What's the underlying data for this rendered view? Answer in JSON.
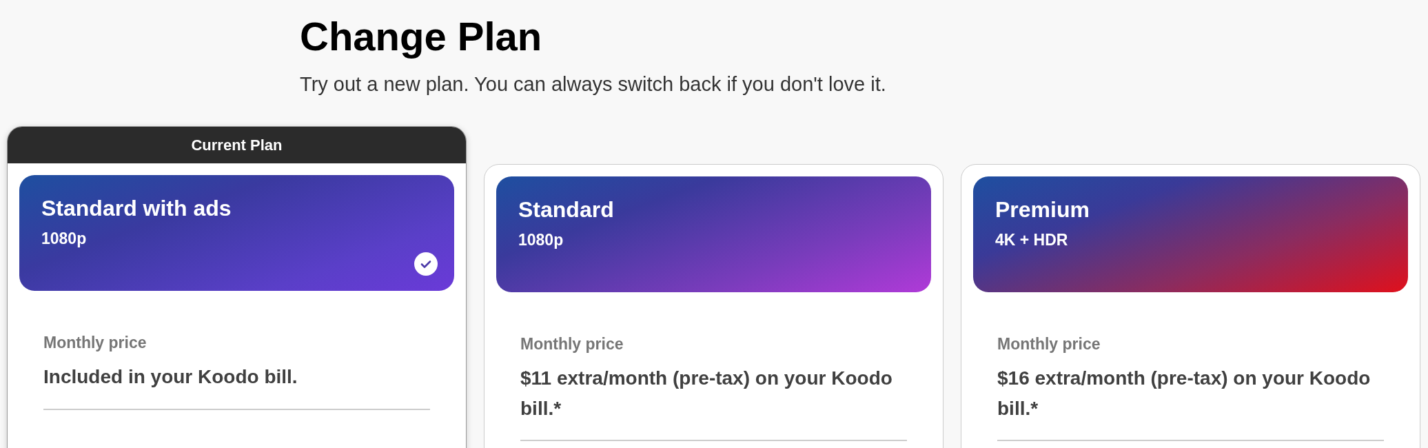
{
  "heading": {
    "title": "Change Plan",
    "subtitle": "Try out a new plan. You can always switch back if you don't love it."
  },
  "plans": [
    {
      "kind": "ads",
      "badge": "Current Plan",
      "name": "Standard with ads",
      "resolution": "1080p",
      "selected": true,
      "price_label": "Monthly price",
      "price": "Included in your Koodo bill."
    },
    {
      "kind": "standard",
      "name": "Standard",
      "resolution": "1080p",
      "selected": false,
      "price_label": "Monthly price",
      "price": "$11 extra/month (pre-tax) on your Koodo bill.*"
    },
    {
      "kind": "premium",
      "name": "Premium",
      "resolution": "4K + HDR",
      "selected": false,
      "price_label": "Monthly price",
      "price": "$16 extra/month (pre-tax) on your Koodo bill.*"
    }
  ]
}
